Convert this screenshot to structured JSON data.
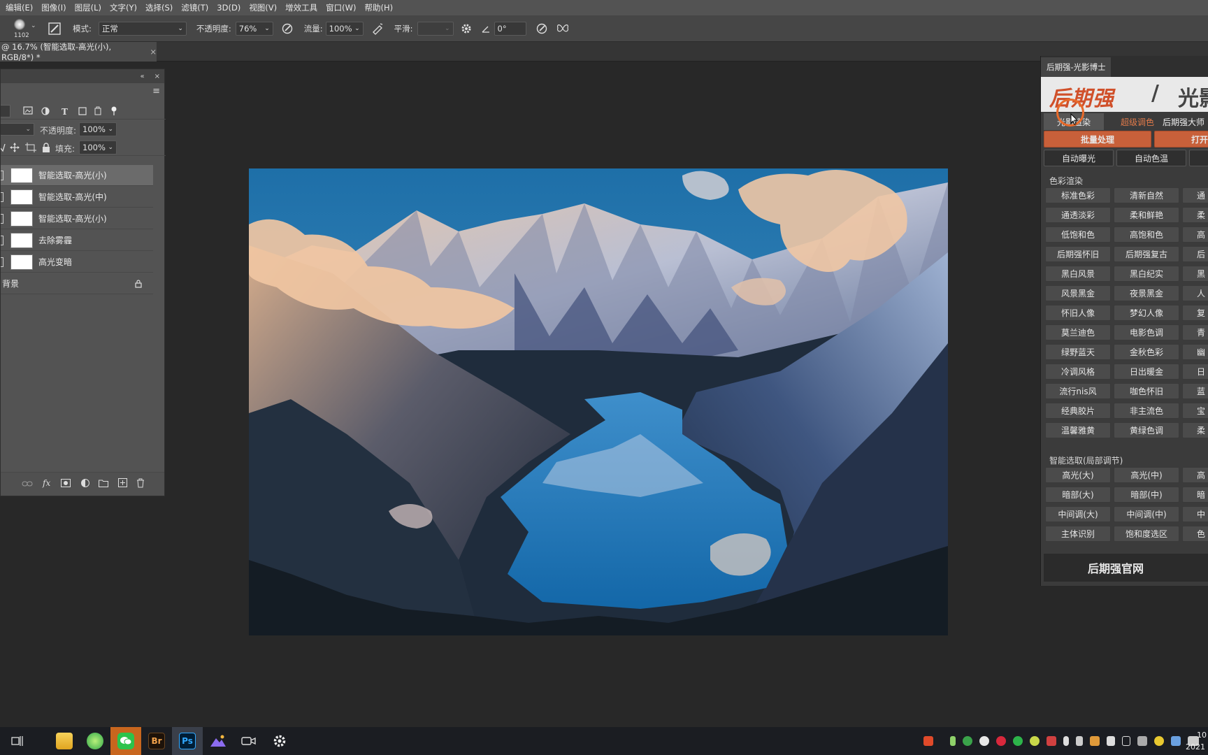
{
  "menubar": {
    "items": [
      "编辑(E)",
      "图像(I)",
      "图层(L)",
      "文字(Y)",
      "选择(S)",
      "滤镜(T)",
      "3D(D)",
      "视图(V)",
      "增效工具",
      "窗口(W)",
      "帮助(H)"
    ]
  },
  "options": {
    "brush_size": "1102",
    "mode_label": "模式:",
    "mode_value": "正常",
    "opacity_label": "不透明度:",
    "opacity_value": "76%",
    "flow_label": "流量:",
    "flow_value": "100%",
    "smooth_label": "平滑:",
    "angle_value": "0°"
  },
  "document": {
    "tab_title": "@ 16.7% (智能选取-高光(小), RGB/8*) *",
    "close_glyph": "×"
  },
  "layers_panel": {
    "collapse_glyph": "«",
    "close_glyph": "×",
    "menu_glyph": "≡",
    "opacity_label": "不透明度:",
    "opacity_value": "100%",
    "fill_label": "填充:",
    "fill_value": "100%",
    "layers": [
      {
        "name": "智能选取-高光(小)",
        "selected": true
      },
      {
        "name": "智能选取-高光(中)",
        "selected": false
      },
      {
        "name": "智能选取-高光(小)",
        "selected": false
      },
      {
        "name": "去除雾霾",
        "selected": false
      },
      {
        "name": "高光变暗",
        "selected": false
      }
    ],
    "background_layer": "背景",
    "footer_fx": "fx"
  },
  "plugin": {
    "panel_title": "后期强-光影博士",
    "brand": "后期强",
    "brand_sep": "/",
    "brand_right": "光影",
    "tabs": [
      "光影渲染",
      "超级调色",
      "后期强大师"
    ],
    "batch_button": "批量处理",
    "open_button": "打开",
    "auto_buttons": [
      "自动曝光",
      "自动色温"
    ],
    "section_color": "色彩渲染",
    "color_grid": [
      [
        "标准色彩",
        "清新自然",
        "通"
      ],
      [
        "通透淡彩",
        "柔和鲜艳",
        "柔"
      ],
      [
        "低饱和色",
        "高饱和色",
        "高"
      ],
      [
        "后期强怀旧",
        "后期强复古",
        "后"
      ],
      [
        "黑白风景",
        "黑白纪实",
        "黑"
      ],
      [
        "风景黑金",
        "夜景黑金",
        "人"
      ],
      [
        "怀旧人像",
        "梦幻人像",
        "复"
      ],
      [
        "莫兰迪色",
        "电影色调",
        "青"
      ],
      [
        "绿野蓝天",
        "金秋色彩",
        "幽"
      ],
      [
        "冷调风格",
        "日出暖金",
        "日"
      ],
      [
        "流行nis风",
        "咖色怀旧",
        "蓝"
      ],
      [
        "经典胶片",
        "非主流色",
        "宝"
      ],
      [
        "温馨雅黄",
        "黄绿色调",
        "柔"
      ]
    ],
    "section_smart": "智能选取(局部调节)",
    "smart_grid": [
      [
        "高光(大)",
        "高光(中)",
        "高"
      ],
      [
        "暗部(大)",
        "暗部(中)",
        "暗"
      ],
      [
        "中间调(大)",
        "中间调(中)",
        "中"
      ],
      [
        "主体识别",
        "饱和度选区",
        "色"
      ]
    ],
    "footer": "后期强官网"
  },
  "taskbar": {
    "apps": [
      "task-view",
      "file-explorer",
      "browser",
      "wechat",
      "bridge",
      "photoshop",
      "photos",
      "camera",
      "settings"
    ],
    "br_label": "Br",
    "ps_label": "Ps",
    "clock_time": "10",
    "clock_date": "2021"
  },
  "colors": {
    "accent_orange": "#c8603a",
    "ps_blue": "#31a8ff",
    "brand_red": "#d0502a"
  }
}
